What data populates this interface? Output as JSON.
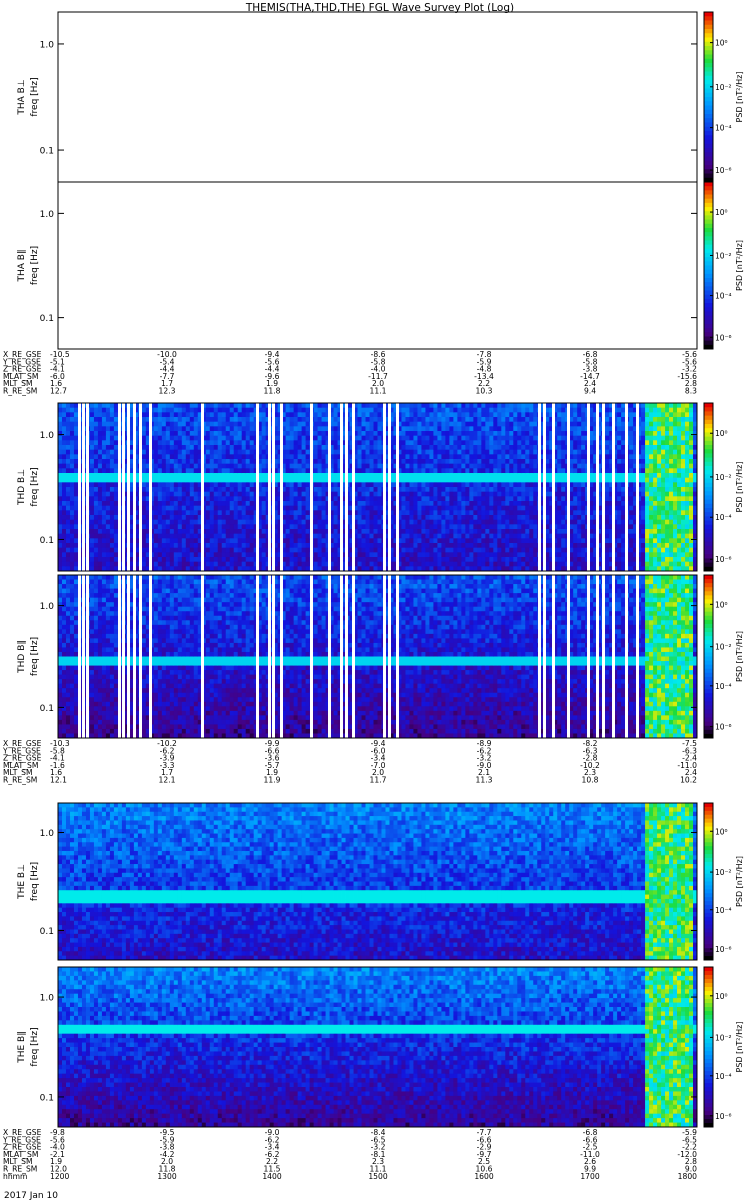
{
  "title": "THEMIS(THA,THD,THE) FGL Wave Survey Plot (Log)",
  "colorbar": {
    "label_html": "PSD [nT²/Hz]",
    "ticks": [
      "10⁰",
      "10⁻²",
      "10⁻⁴",
      "10⁻⁶"
    ]
  },
  "freq_ticks": [
    "1.0",
    "0.1"
  ],
  "panels": [
    {
      "probe": "THA",
      "component": "B⊥",
      "ylabel": "THA B⊥",
      "unit": "freq [Hz]",
      "has_data": false
    },
    {
      "probe": "THA",
      "component": "B∥",
      "ylabel": "THA B∥",
      "unit": "freq [Hz]",
      "has_data": false
    },
    {
      "probe": "THD",
      "component": "B⊥",
      "ylabel": "THD B⊥",
      "unit": "freq [Hz]",
      "has_data": true
    },
    {
      "probe": "THD",
      "component": "B∥",
      "ylabel": "THD B∥",
      "unit": "freq [Hz]",
      "has_data": true
    },
    {
      "probe": "THE",
      "component": "B⊥",
      "ylabel": "THE B⊥",
      "unit": "freq [Hz]",
      "has_data": true
    },
    {
      "probe": "THE",
      "component": "B∥",
      "ylabel": "THE B∥",
      "unit": "freq [Hz]",
      "has_data": true
    }
  ],
  "ephemeris_blocks": [
    {
      "probe": "THA",
      "rows": [
        {
          "label": "X_RE_GSE",
          "values": [
            "-10.5",
            "-10.0",
            "-9.4",
            "-8.6",
            "-7.8",
            "-6.8",
            "-5.6"
          ]
        },
        {
          "label": "Y_RE_GSE",
          "values": [
            "-5.1",
            "-5.4",
            "-5.6",
            "-5.8",
            "-5.9",
            "-5.8",
            "-5.6"
          ]
        },
        {
          "label": "Z_RE_GSE",
          "values": [
            "-4.1",
            "-4.4",
            "-4.4",
            "-4.0",
            "-4.8",
            "-3.8",
            "-3.2"
          ]
        },
        {
          "label": "MLAT_SM",
          "values": [
            "-6.0",
            "-7.7",
            "-9.6",
            "-11.7",
            "-13.4",
            "-14.7",
            "-15.6"
          ]
        },
        {
          "label": "MLT_SM",
          "values": [
            "1.6",
            "1.7",
            "1.9",
            "2.0",
            "2.2",
            "2.4",
            "2.8"
          ]
        },
        {
          "label": "R_RE_SM",
          "values": [
            "12.7",
            "12.3",
            "11.8",
            "11.1",
            "10.3",
            "9.4",
            "8.3"
          ]
        }
      ]
    },
    {
      "probe": "THD",
      "rows": [
        {
          "label": "X_RE_GSE",
          "values": [
            "-10.3",
            "-10.2",
            "-9.9",
            "-9.4",
            "-8.9",
            "-8.2",
            "-7.5"
          ]
        },
        {
          "label": "Y_RE_GSE",
          "values": [
            "-5.8",
            "-6.2",
            "-6.6",
            "-6.0",
            "-6.2",
            "-6.3",
            "-6.3"
          ]
        },
        {
          "label": "Z_RE_GSE",
          "values": [
            "-4.1",
            "-3.9",
            "-3.6",
            "-3.4",
            "-3.2",
            "-2.8",
            "-2.4"
          ]
        },
        {
          "label": "MLAT_SM",
          "values": [
            "-1.6",
            "-3.3",
            "-5.7",
            "-7.0",
            "-9.0",
            "-10.2",
            "-11.0"
          ]
        },
        {
          "label": "MLT_SM",
          "values": [
            "1.6",
            "1.7",
            "1.9",
            "2.0",
            "2.1",
            "2.3",
            "2.4"
          ]
        },
        {
          "label": "R_RE_SM",
          "values": [
            "12.1",
            "12.1",
            "11.9",
            "11.7",
            "11.3",
            "10.8",
            "10.2"
          ]
        }
      ]
    },
    {
      "probe": "THE",
      "rows": [
        {
          "label": "X_RE_GSE",
          "values": [
            "-9.8",
            "-9.5",
            "-9.0",
            "-8.4",
            "-7.7",
            "-6.8",
            "-5.9"
          ]
        },
        {
          "label": "Y_RE_GSE",
          "values": [
            "-5.6",
            "-5.9",
            "-6.2",
            "-6.5",
            "-6.6",
            "-6.6",
            "-6.5"
          ]
        },
        {
          "label": "Z_RE_GSE",
          "values": [
            "-4.0",
            "-3.8",
            "-3.4",
            "-3.2",
            "-2.9",
            "-2.5",
            "-2.2"
          ]
        },
        {
          "label": "MLAT_SM",
          "values": [
            "-2.1",
            "-4.2",
            "-6.2",
            "-8.1",
            "-9.7",
            "-11.0",
            "-12.0"
          ]
        },
        {
          "label": "MLT_SM",
          "values": [
            "1.9",
            "2.0",
            "2.2",
            "2.3",
            "2.5",
            "2.6",
            "2.8"
          ]
        },
        {
          "label": "R_RE_SM",
          "values": [
            "12.0",
            "11.8",
            "11.5",
            "11.1",
            "10.6",
            "9.9",
            "9.0"
          ]
        },
        {
          "label": "hhmm",
          "values": [
            "1200",
            "1300",
            "1400",
            "1500",
            "1600",
            "1700",
            "1800"
          ]
        }
      ]
    }
  ],
  "date_label": "2017 Jan 10",
  "chart_data": {
    "type": "heatmap",
    "title": "THEMIS(THA,THD,THE) FGL Wave Survey Plot (Log)",
    "x_axis": {
      "label": "hhmm",
      "ticks": [
        "1200",
        "1300",
        "1400",
        "1500",
        "1600",
        "1700",
        "1800"
      ],
      "date": "2017 Jan 10"
    },
    "y_axis": {
      "label": "freq [Hz]",
      "scale": "log",
      "ticks": [
        1.0,
        0.1
      ],
      "range_hz": [
        0.05,
        2.0
      ]
    },
    "colorbar": {
      "label": "PSD [nT^2/Hz]",
      "scale": "log",
      "ticks": [
        "1e0",
        "1e-2",
        "1e-4",
        "1e-6"
      ],
      "colormap": "rainbow (black-purple-blue-cyan-green-yellow-red)"
    },
    "panels": [
      {
        "name": "THA B⊥",
        "data": "none"
      },
      {
        "name": "THA B∥",
        "data": "none"
      },
      {
        "name": "THD B⊥",
        "data": "spectrogram",
        "features": [
          "narrowband enhancements near 0.3 Hz and above 0.8 Hz",
          "broadband wave activity near 1645-1655 hhmm"
        ]
      },
      {
        "name": "THD B∥",
        "data": "spectrogram",
        "features": [
          "data gaps (white vertical stripes)",
          "broadband wave activity near 1645-1655 hhmm"
        ]
      },
      {
        "name": "THE B⊥",
        "data": "spectrogram",
        "features": [
          "band near 0.25 Hz",
          "broadband wave activity near 1645-1700 hhmm"
        ]
      },
      {
        "name": "THE B∥",
        "data": "spectrogram",
        "features": [
          "band near 0.45 Hz",
          "broadband wave activity near 1645-1700 hhmm"
        ]
      }
    ]
  }
}
